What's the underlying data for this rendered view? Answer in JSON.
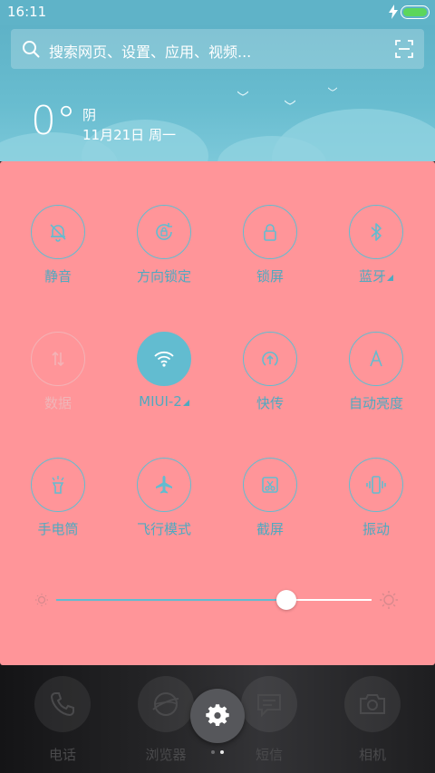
{
  "status_bar": {
    "time": "16:11"
  },
  "search": {
    "placeholder": "搜索网页、设置、应用、视频..."
  },
  "weather": {
    "temperature": "0°",
    "condition": "阴",
    "date": "11月21日 周一"
  },
  "toggles": [
    {
      "label": "静音",
      "icon": "mute-bell-icon",
      "state": "off"
    },
    {
      "label": "方向锁定",
      "icon": "rotation-lock-icon",
      "state": "off"
    },
    {
      "label": "锁屏",
      "icon": "lock-icon",
      "state": "off"
    },
    {
      "label": "蓝牙",
      "icon": "bluetooth-icon",
      "state": "off"
    },
    {
      "label": "数据",
      "icon": "mobile-data-icon",
      "state": "disabled"
    },
    {
      "label": "MIUI-2",
      "icon": "wifi-icon",
      "state": "on"
    },
    {
      "label": "快传",
      "icon": "quick-transfer-icon",
      "state": "off"
    },
    {
      "label": "自动亮度",
      "icon": "auto-brightness-icon",
      "state": "off"
    },
    {
      "label": "手电筒",
      "icon": "flashlight-icon",
      "state": "off"
    },
    {
      "label": "飞行模式",
      "icon": "airplane-icon",
      "state": "off"
    },
    {
      "label": "截屏",
      "icon": "screenshot-icon",
      "state": "off"
    },
    {
      "label": "振动",
      "icon": "vibrate-icon",
      "state": "off"
    }
  ],
  "brightness": {
    "level": 0.73
  },
  "dock": [
    {
      "label": "电话",
      "icon": "phone-icon"
    },
    {
      "label": "浏览器",
      "icon": "browser-icon"
    },
    {
      "label": "短信",
      "icon": "message-icon"
    },
    {
      "label": "相机",
      "icon": "camera-icon"
    }
  ],
  "pager": {
    "pages": 2,
    "current": 2
  },
  "colors": {
    "accent": "#62bcd0",
    "panel": "#ff9599",
    "header": "#5fb3c8"
  }
}
